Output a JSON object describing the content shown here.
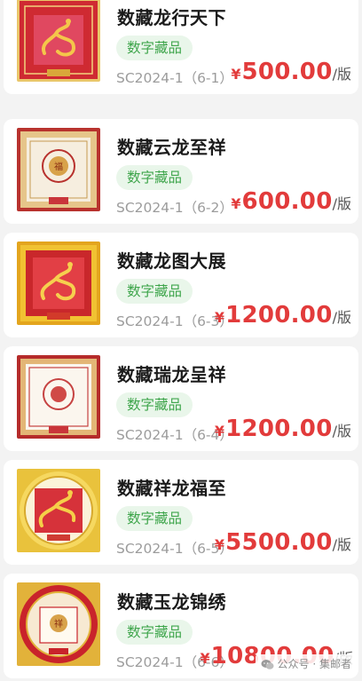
{
  "items": [
    {
      "title": "数藏龙行天下",
      "tag": "数字藏品",
      "code": "SC2024-1（6-1）",
      "currency": "¥",
      "amount": "500.00",
      "unit": "/版",
      "image": "dragon-stamp-red"
    },
    {
      "title": "数藏云龙至祥",
      "tag": "数字藏品",
      "code": "SC2024-1（6-2）",
      "currency": "¥",
      "amount": "600.00",
      "unit": "/版",
      "image": "cloud-dragon-stamp-white"
    },
    {
      "title": "数藏龙图大展",
      "tag": "数字藏品",
      "code": "SC2024-1（6-3）",
      "currency": "¥",
      "amount": "1200.00",
      "unit": "/版",
      "image": "dragon-stamp-orange"
    },
    {
      "title": "数藏瑞龙呈祥",
      "tag": "数字藏品",
      "code": "SC2024-1（6-4）",
      "currency": "¥",
      "amount": "1200.00",
      "unit": "/版",
      "image": "dragon-stamp-white-red-frame"
    },
    {
      "title": "数藏祥龙福至",
      "tag": "数字藏品",
      "code": "SC2024-1（6-5）",
      "currency": "¥",
      "amount": "5500.00",
      "unit": "/版",
      "image": "dragon-stamp-round-gold"
    },
    {
      "title": "数藏玉龙锦绣",
      "tag": "数字藏品",
      "code": "SC2024-1（6-6）",
      "currency": "¥",
      "amount": "10800.00",
      "unit": "/版",
      "image": "dragon-stamp-round-red"
    }
  ],
  "watermark": {
    "text": "公众号 · 集邮者",
    "icon": "wechat-icon"
  },
  "colors": {
    "price": "#e23b3b",
    "tag_text": "#40a64d",
    "tag_bg": "#e9f6ea",
    "code": "#9c9c9c"
  }
}
